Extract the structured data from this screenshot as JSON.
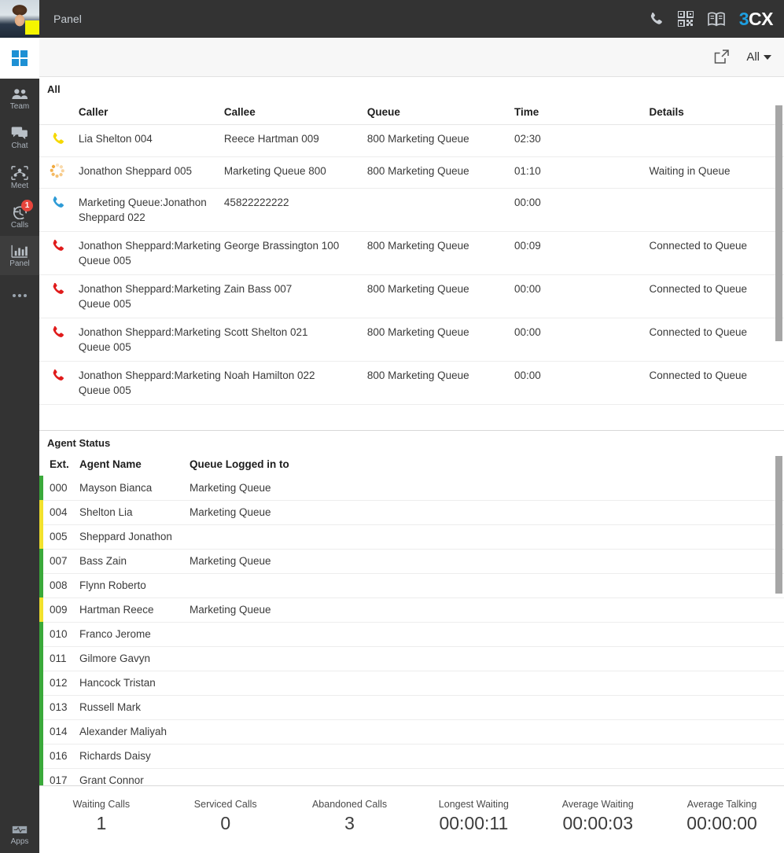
{
  "sidebar": {
    "avatar": {
      "name": "user-avatar",
      "status_color": "#f5f500"
    },
    "windows_logo": "windows-logo",
    "items": [
      {
        "label": "Team",
        "icon": "team-icon",
        "active": false,
        "badge": ""
      },
      {
        "label": "Chat",
        "icon": "chat-icon",
        "active": false,
        "badge": ""
      },
      {
        "label": "Meet",
        "icon": "meet-icon",
        "active": false,
        "badge": ""
      },
      {
        "label": "Calls",
        "icon": "calls-icon",
        "active": false,
        "badge": "1"
      },
      {
        "label": "Panel",
        "icon": "panel-icon",
        "active": true,
        "badge": ""
      }
    ],
    "more_label": "more-options",
    "apps": {
      "label": "Apps",
      "icon": "apps-icon"
    }
  },
  "topbar": {
    "title": "Panel",
    "icons": [
      "phone-icon",
      "qrcode-icon",
      "book-icon"
    ],
    "brand_first": "3",
    "brand_rest": "CX"
  },
  "toolbar": {
    "popout_icon": "popout-icon",
    "filter_label": "All"
  },
  "calls": {
    "section_title": "All",
    "columns": [
      "",
      "Caller",
      "Callee",
      "Queue",
      "Time",
      "Details"
    ],
    "rows": [
      {
        "icon": "phone-ringing-icon",
        "icon_color": "#f5d800",
        "caller": "Lia Shelton 004",
        "callee": "Reece Hartman 009",
        "queue": "800 Marketing Queue",
        "time": "02:30",
        "details": ""
      },
      {
        "icon": "waiting-spinner-icon",
        "icon_color": "#f0a02a",
        "caller": "Jonathon Sheppard 005",
        "callee": "Marketing Queue 800",
        "queue": "800 Marketing Queue",
        "time": "01:10",
        "details": "Waiting in Queue"
      },
      {
        "icon": "phone-outbound-icon",
        "icon_color": "#2e9bd6",
        "caller": "Marketing Queue:Jonathon Sheppard 022",
        "callee": "45822222222",
        "queue": "",
        "time": "00:00",
        "details": ""
      },
      {
        "icon": "phone-connected-icon",
        "icon_color": "#e01b1b",
        "caller": "Jonathon Sheppard:Marketing Queue 005",
        "callee": "George Brassington 100",
        "queue": "800 Marketing Queue",
        "time": "00:09",
        "details": "Connected to Queue"
      },
      {
        "icon": "phone-connected-icon",
        "icon_color": "#e01b1b",
        "caller": "Jonathon Sheppard:Marketing Queue 005",
        "callee": "Zain Bass 007",
        "queue": "800 Marketing Queue",
        "time": "00:00",
        "details": "Connected to Queue"
      },
      {
        "icon": "phone-connected-icon",
        "icon_color": "#e01b1b",
        "caller": "Jonathon Sheppard:Marketing Queue 005",
        "callee": "Scott Shelton 021",
        "queue": "800 Marketing Queue",
        "time": "00:00",
        "details": "Connected to Queue"
      },
      {
        "icon": "phone-connected-icon",
        "icon_color": "#e01b1b",
        "caller": "Jonathon Sheppard:Marketing Queue 005",
        "callee": "Noah Hamilton 022",
        "queue": "800 Marketing Queue",
        "time": "00:00",
        "details": "Connected to Queue"
      }
    ]
  },
  "agents": {
    "section_title": "Agent Status",
    "columns": [
      "Ext.",
      "Agent Name",
      "Queue Logged in to"
    ],
    "rows": [
      {
        "status_color": "#3aa93a",
        "ext": "000",
        "name": "Mayson Bianca",
        "queue": "Marketing Queue"
      },
      {
        "status_color": "#f2e12c",
        "ext": "004",
        "name": "Shelton Lia",
        "queue": "Marketing Queue"
      },
      {
        "status_color": "#f2e12c",
        "ext": "005",
        "name": "Sheppard Jonathon",
        "queue": ""
      },
      {
        "status_color": "#3aa93a",
        "ext": "007",
        "name": "Bass Zain",
        "queue": "Marketing Queue"
      },
      {
        "status_color": "#3aa93a",
        "ext": "008",
        "name": "Flynn Roberto",
        "queue": ""
      },
      {
        "status_color": "#f2e12c",
        "ext": "009",
        "name": "Hartman Reece",
        "queue": "Marketing Queue"
      },
      {
        "status_color": "#3aa93a",
        "ext": "010",
        "name": "Franco Jerome",
        "queue": ""
      },
      {
        "status_color": "#3aa93a",
        "ext": "011",
        "name": "Gilmore Gavyn",
        "queue": ""
      },
      {
        "status_color": "#3aa93a",
        "ext": "012",
        "name": "Hancock Tristan",
        "queue": ""
      },
      {
        "status_color": "#3aa93a",
        "ext": "013",
        "name": "Russell Mark",
        "queue": ""
      },
      {
        "status_color": "#3aa93a",
        "ext": "014",
        "name": "Alexander Maliyah",
        "queue": ""
      },
      {
        "status_color": "#3aa93a",
        "ext": "016",
        "name": "Richards Daisy",
        "queue": ""
      },
      {
        "status_color": "#3aa93a",
        "ext": "017",
        "name": "Grant Connor",
        "queue": ""
      }
    ]
  },
  "stats": [
    {
      "label": "Waiting Calls",
      "value": "1"
    },
    {
      "label": "Serviced Calls",
      "value": "0"
    },
    {
      "label": "Abandoned Calls",
      "value": "3"
    },
    {
      "label": "Longest Waiting",
      "value": "00:00:11"
    },
    {
      "label": "Average Waiting",
      "value": "00:00:03"
    },
    {
      "label": "Average Talking",
      "value": "00:00:00"
    }
  ]
}
